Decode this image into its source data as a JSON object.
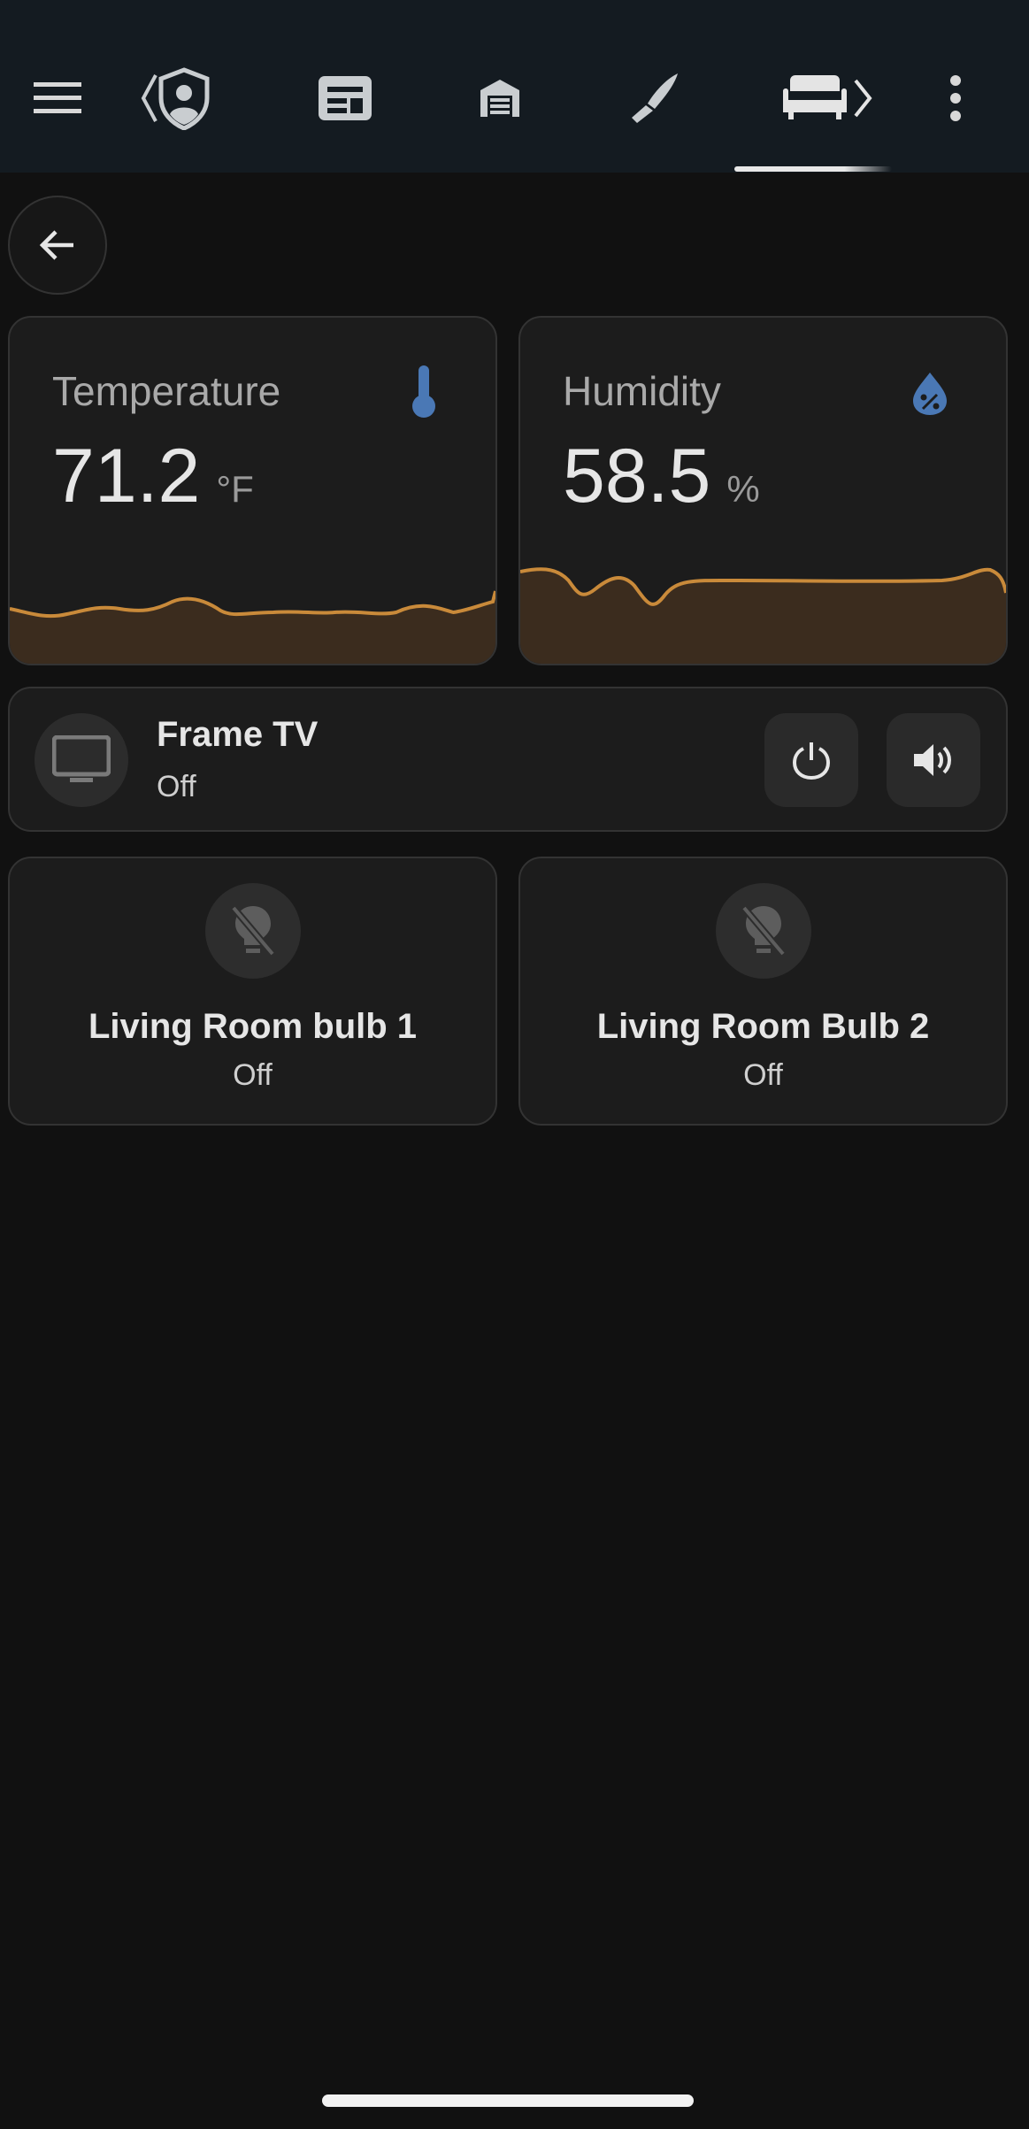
{
  "topbar": {
    "icons": [
      "menu-icon",
      "account-shield-icon",
      "newspaper-icon",
      "garage-icon",
      "knife-icon",
      "sofa-icon",
      "more-vertical-icon"
    ],
    "active_tab": "sofa-icon"
  },
  "back": {
    "icon": "arrow-left-icon"
  },
  "sensors": [
    {
      "name": "Temperature",
      "value": "71.2",
      "unit": "°F",
      "icon": "thermometer-icon",
      "icon_color": "#4a78b5"
    },
    {
      "name": "Humidity",
      "value": "58.5",
      "unit": "%",
      "icon": "water-percent-icon",
      "icon_color": "#4a78b5"
    }
  ],
  "graph_color": "#c98a3a",
  "media": {
    "name": "Frame TV",
    "state": "Off",
    "icon": "television-icon",
    "buttons": [
      "power-icon",
      "volume-icon"
    ]
  },
  "lights": [
    {
      "name": "Living Room bulb 1",
      "state": "Off",
      "icon": "lightbulb-off-icon"
    },
    {
      "name": "Living Room Bulb 2",
      "state": "Off",
      "icon": "lightbulb-off-icon"
    }
  ]
}
